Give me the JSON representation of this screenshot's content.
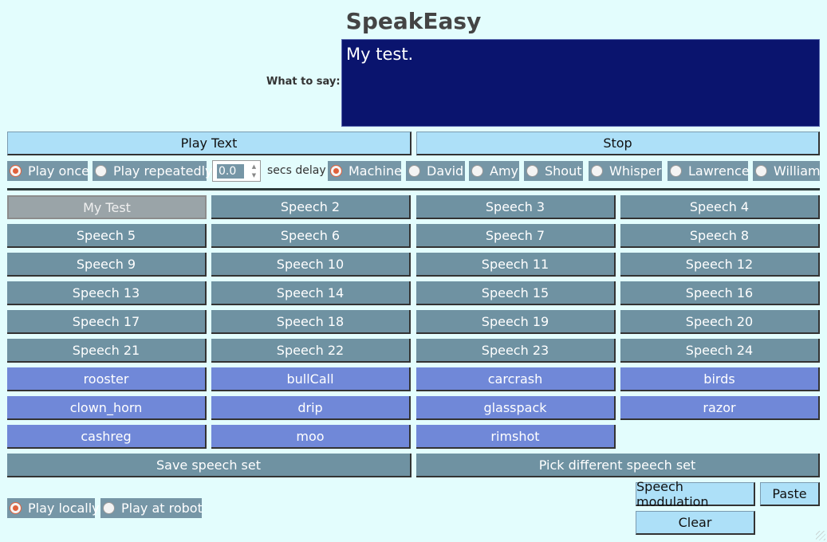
{
  "app": {
    "title": "SpeakEasy"
  },
  "say": {
    "label": "What to say:",
    "text": "My test."
  },
  "controls": {
    "play_text": "Play Text",
    "stop": "Stop"
  },
  "play_mode": {
    "once": "Play once",
    "repeatedly": "Play repeatedly",
    "selected": "once"
  },
  "delay": {
    "value": "0.0",
    "label": "secs delay"
  },
  "voices": {
    "items": [
      "Machine",
      "David",
      "Amy",
      "Shout",
      "Whisper",
      "Lawrence",
      "William"
    ],
    "selected": "Machine"
  },
  "speeches": [
    "My Test",
    "Speech 2",
    "Speech 3",
    "Speech 4",
    "Speech 5",
    "Speech 6",
    "Speech 7",
    "Speech 8",
    "Speech 9",
    "Speech 10",
    "Speech 11",
    "Speech 12",
    "Speech 13",
    "Speech 14",
    "Speech 15",
    "Speech 16",
    "Speech 17",
    "Speech 18",
    "Speech 19",
    "Speech 20",
    "Speech 21",
    "Speech 22",
    "Speech 23",
    "Speech 24"
  ],
  "sounds": [
    "rooster",
    "bullCall",
    "carcrash",
    "birds",
    "clown_horn",
    "drip",
    "glasspack",
    "razor",
    "cashreg",
    "moo",
    "rimshot"
  ],
  "speech_set": {
    "save": "Save speech set",
    "pick": "Pick different speech set"
  },
  "output": {
    "locally": "Play locally",
    "robot": "Play at robot",
    "selected": "locally"
  },
  "actions": {
    "modulation": "Speech modulation",
    "paste": "Paste",
    "clear": "Clear"
  },
  "colors": {
    "background": "#e3fdfd",
    "speech_button": "#6f92a2",
    "sound_button": "#7088d8",
    "light_button": "#ade0f8",
    "text_box": "#0a146e"
  }
}
